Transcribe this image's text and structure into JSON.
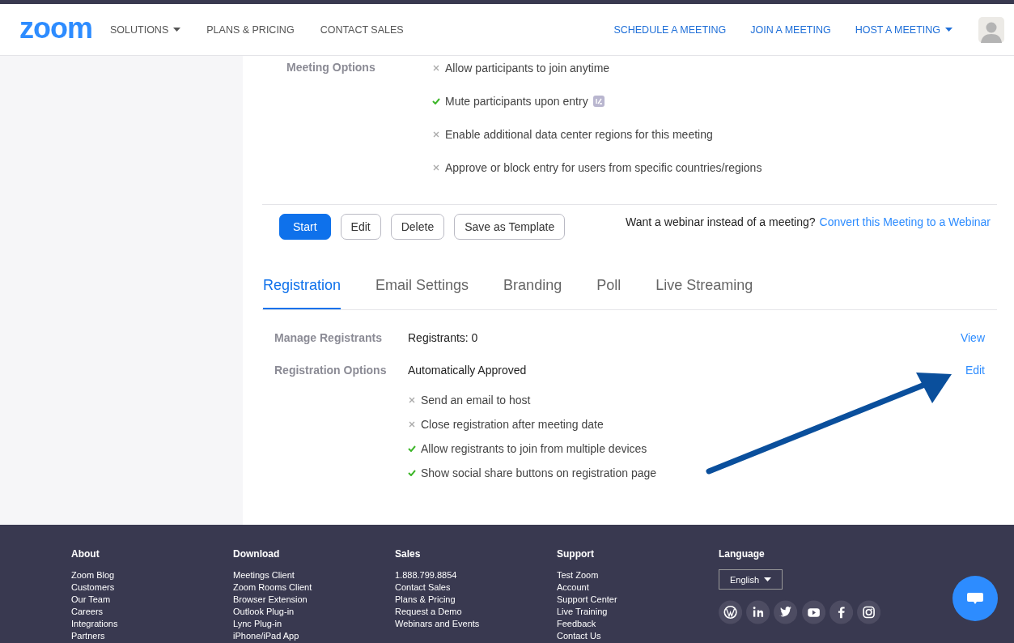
{
  "header": {
    "logo": "zoom",
    "nav_left": [
      {
        "label": "SOLUTIONS",
        "dropdown": true
      },
      {
        "label": "PLANS & PRICING",
        "dropdown": false
      },
      {
        "label": "CONTACT SALES",
        "dropdown": false
      }
    ],
    "nav_right": [
      {
        "label": "SCHEDULE A MEETING",
        "dropdown": false
      },
      {
        "label": "JOIN A MEETING",
        "dropdown": false
      },
      {
        "label": "HOST A MEETING",
        "dropdown": true
      }
    ]
  },
  "meeting_options": {
    "label": "Meeting Options",
    "options": [
      {
        "text": "Allow participants to join anytime",
        "checked": false,
        "badge": false
      },
      {
        "text": "Mute participants upon entry",
        "checked": true,
        "badge": true
      },
      {
        "text": "Enable additional data center regions for this meeting",
        "checked": false,
        "badge": false
      },
      {
        "text": "Approve or block entry for users from specific countries/regions",
        "checked": false,
        "badge": false
      }
    ]
  },
  "actions": [
    {
      "label": "Start",
      "kind": "primary"
    },
    {
      "label": "Edit",
      "kind": "outline"
    },
    {
      "label": "Delete",
      "kind": "outline"
    },
    {
      "label": "Save as Template",
      "kind": "outline"
    }
  ],
  "webinar_prompt": {
    "text": "Want a webinar instead of a meeting?",
    "link": "Convert this Meeting to a Webinar"
  },
  "tabs": [
    {
      "label": "Registration",
      "selected": true
    },
    {
      "label": "Email Settings",
      "selected": false
    },
    {
      "label": "Branding",
      "selected": false
    },
    {
      "label": "Poll",
      "selected": false
    },
    {
      "label": "Live Streaming",
      "selected": false
    }
  ],
  "registration": {
    "manage_label": "Manage Registrants",
    "registrants": "Registrants: 0",
    "view_link": "View",
    "options_label": "Registration Options",
    "approval": "Automatically Approved",
    "edit_link": "Edit",
    "options": [
      {
        "text": "Send an email to host",
        "checked": false
      },
      {
        "text": "Close registration after meeting date",
        "checked": false
      },
      {
        "text": "Allow registrants to join from multiple devices",
        "checked": true
      },
      {
        "text": "Show social share buttons on registration page",
        "checked": true
      }
    ]
  },
  "footer": {
    "columns": [
      {
        "heading": "About",
        "links": [
          "Zoom Blog",
          "Customers",
          "Our Team",
          "Careers",
          "Integrations",
          "Partners"
        ]
      },
      {
        "heading": "Download",
        "links": [
          "Meetings Client",
          "Zoom Rooms Client",
          "Browser Extension",
          "Outlook Plug-in",
          "Lync Plug-in",
          "iPhone/iPad App"
        ]
      },
      {
        "heading": "Sales",
        "links": [
          "1.888.799.8854",
          "Contact Sales",
          "Plans & Pricing",
          "Request a Demo",
          "Webinars and Events"
        ]
      },
      {
        "heading": "Support",
        "links": [
          "Test Zoom",
          "Account",
          "Support Center",
          "Live Training",
          "Feedback",
          "Contact Us"
        ]
      }
    ],
    "language_heading": "Language",
    "language": "English",
    "social": [
      {
        "kind": "wordpress"
      },
      {
        "kind": "linkedin"
      },
      {
        "kind": "twitter"
      },
      {
        "kind": "youtube"
      },
      {
        "kind": "facebook"
      },
      {
        "kind": "instagram"
      }
    ]
  }
}
